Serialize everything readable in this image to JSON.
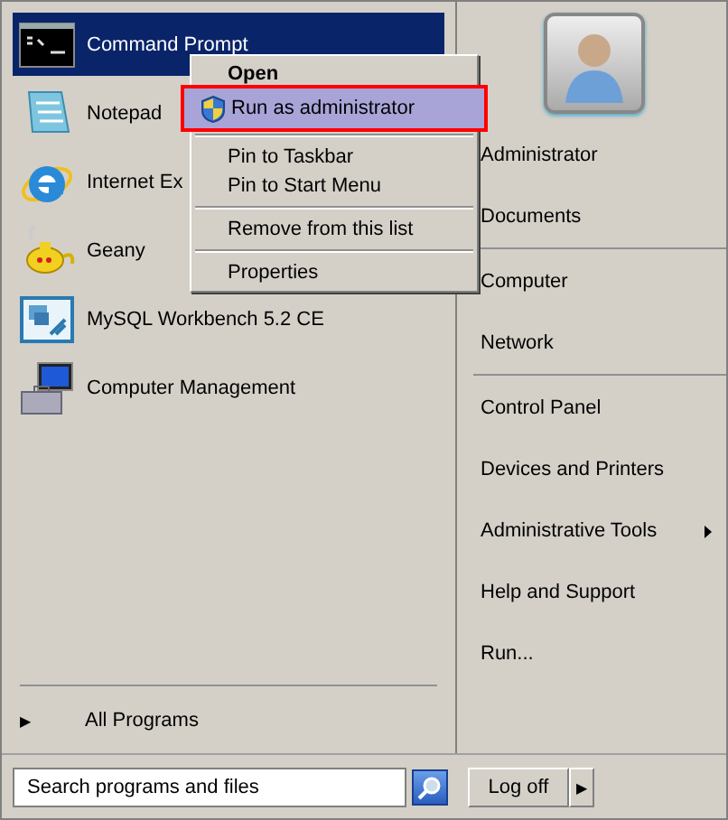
{
  "programs": [
    {
      "label": "Command Prompt",
      "kind": "console",
      "selected": true
    },
    {
      "label": "Notepad",
      "kind": "notepad",
      "selected": false
    },
    {
      "label": "Internet Ex",
      "kind": "browser",
      "selected": false
    },
    {
      "label": "Geany",
      "kind": "teapot",
      "selected": false
    },
    {
      "label": "MySQL Workbench 5.2 CE",
      "kind": "workbench",
      "selected": false
    },
    {
      "label": "Computer Management",
      "kind": "management",
      "selected": false
    }
  ],
  "all_programs": {
    "arrow": "▶",
    "label": "All Programs"
  },
  "places": [
    {
      "items": [
        {
          "label": "Administrator",
          "has_submenu": false
        },
        {
          "label": "Documents",
          "has_submenu": false
        }
      ]
    },
    {
      "items": [
        {
          "label": "Computer",
          "has_submenu": false
        },
        {
          "label": "Network",
          "has_submenu": false
        }
      ]
    },
    {
      "items": [
        {
          "label": "Control Panel",
          "has_submenu": false
        },
        {
          "label": "Devices and Printers",
          "has_submenu": false
        },
        {
          "label": "Administrative Tools",
          "has_submenu": true
        },
        {
          "label": "Help and Support",
          "has_submenu": false
        },
        {
          "label": "Run...",
          "has_submenu": false
        }
      ]
    }
  ],
  "search": {
    "placeholder": "Search programs and files"
  },
  "power": {
    "label": "Log off",
    "arrow": "▶"
  },
  "context_menu": [
    {
      "items": [
        {
          "label": "Open",
          "default": true,
          "selected": false,
          "shield": false
        },
        {
          "label": "Run as administrator",
          "default": false,
          "selected": true,
          "shield": true
        }
      ]
    },
    {
      "items": [
        {
          "label": "Pin to Taskbar",
          "default": false,
          "selected": false,
          "shield": false
        },
        {
          "label": "Pin to Start Menu",
          "default": false,
          "selected": false,
          "shield": false
        }
      ]
    },
    {
      "items": [
        {
          "label": "Remove from this list",
          "default": false,
          "selected": false,
          "shield": false
        }
      ]
    },
    {
      "items": [
        {
          "label": "Properties",
          "default": false,
          "selected": false,
          "shield": false
        }
      ]
    }
  ]
}
